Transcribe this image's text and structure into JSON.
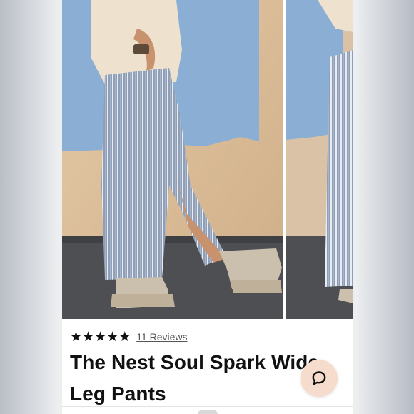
{
  "product": {
    "rating_stars": [
      "★",
      "★",
      "★",
      "★",
      "★"
    ],
    "reviews_label": "11 Reviews",
    "title": "The Nest Soul Spark Wide Leg Pants"
  },
  "gallery": {
    "images": [
      {
        "icon": "product-photo-main"
      },
      {
        "icon": "product-photo-next"
      }
    ]
  },
  "chat": {
    "icon": "chat-bubble-icon"
  },
  "colors": {
    "accent_chat": "#f6dccd",
    "text": "#111111",
    "link": "#555555"
  }
}
